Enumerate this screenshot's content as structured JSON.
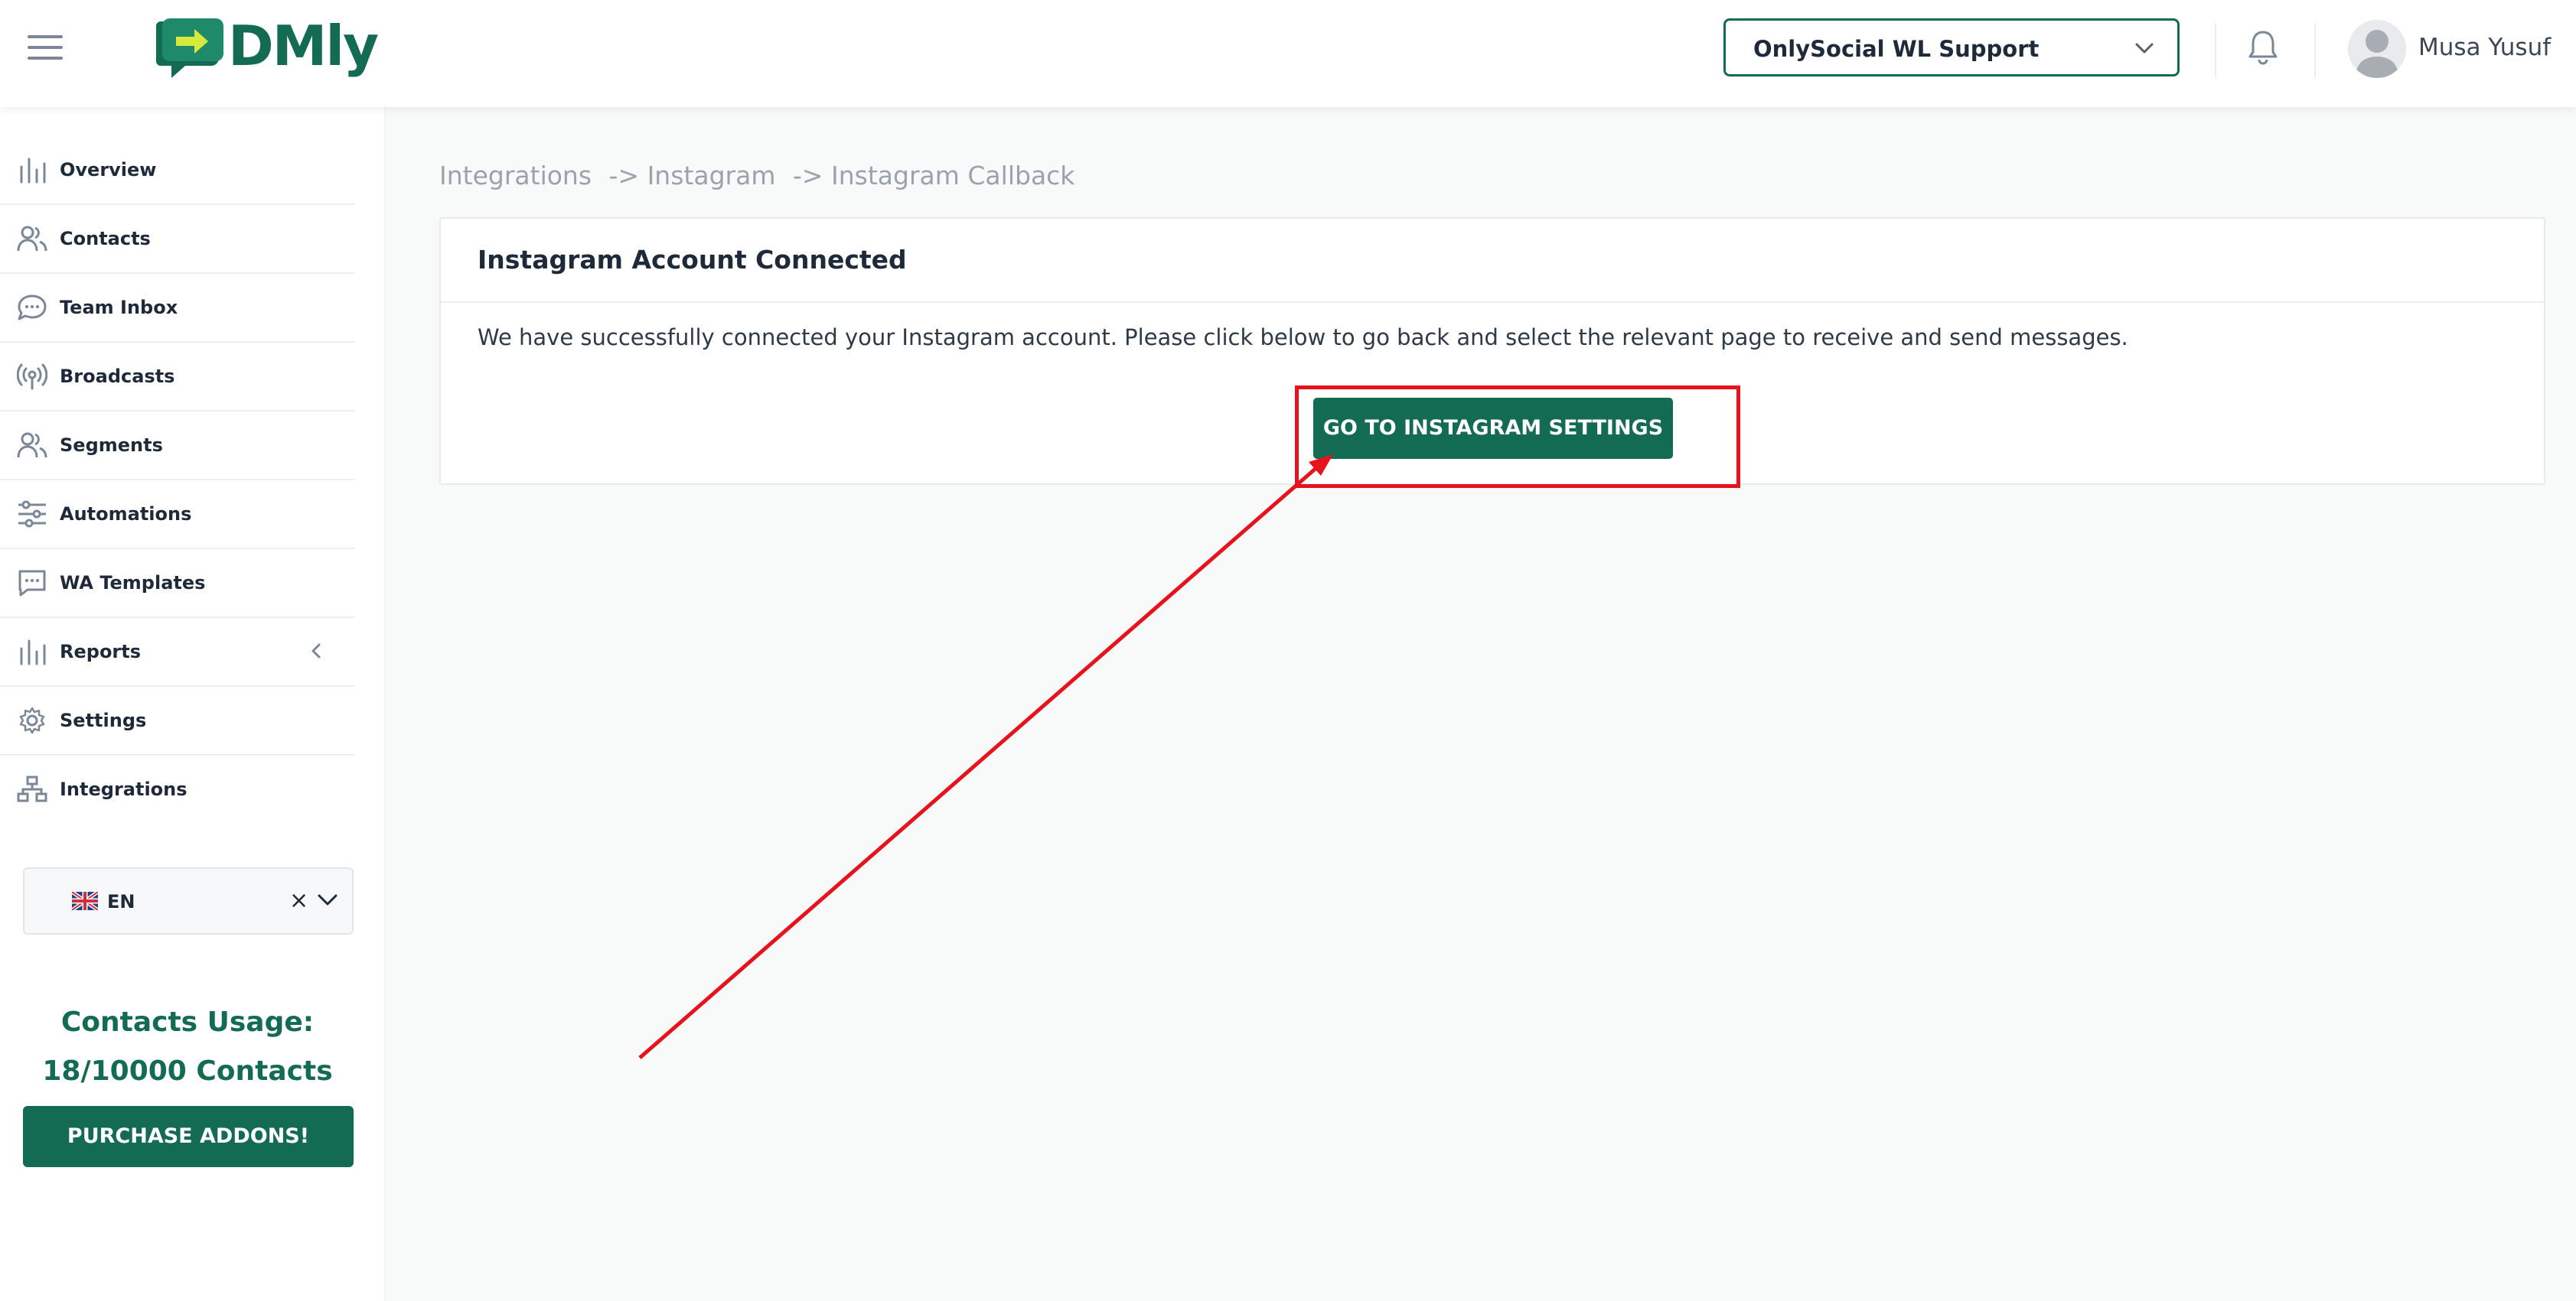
{
  "header": {
    "brand": "DMly",
    "account_selector": "OnlySocial WL Support",
    "user_name": "Musa Yusuf"
  },
  "sidebar": {
    "items": [
      {
        "label": "Overview",
        "icon": "bar-chart-icon"
      },
      {
        "label": "Contacts",
        "icon": "users-icon"
      },
      {
        "label": "Team Inbox",
        "icon": "chat-bubble-icon"
      },
      {
        "label": "Broadcasts",
        "icon": "broadcast-icon"
      },
      {
        "label": "Segments",
        "icon": "users-icon"
      },
      {
        "label": "Automations",
        "icon": "sliders-icon"
      },
      {
        "label": "WA Templates",
        "icon": "message-square-icon"
      },
      {
        "label": "Reports",
        "icon": "bar-chart-icon"
      },
      {
        "label": "Settings",
        "icon": "gear-icon"
      },
      {
        "label": "Integrations",
        "icon": "network-icon"
      }
    ],
    "language": {
      "code": "EN",
      "clear": "×"
    },
    "usage": {
      "title": "Contacts Usage:",
      "value": "18/10000 Contacts"
    },
    "purchase_label": "PURCHASE ADDONS!"
  },
  "main": {
    "breadcrumb": [
      "Integrations",
      "-> Instagram",
      "-> Instagram Callback"
    ],
    "card": {
      "title": "Instagram Account Connected",
      "message": "We have successfully connected your Instagram account. Please click below to go back and select the relevant page to receive and send messages.",
      "button_label": "GO TO INSTAGRAM SETTINGS"
    }
  },
  "colors": {
    "brand_green": "#146b53",
    "annotation_red": "#e8121c",
    "background": "#f8f9f9"
  }
}
